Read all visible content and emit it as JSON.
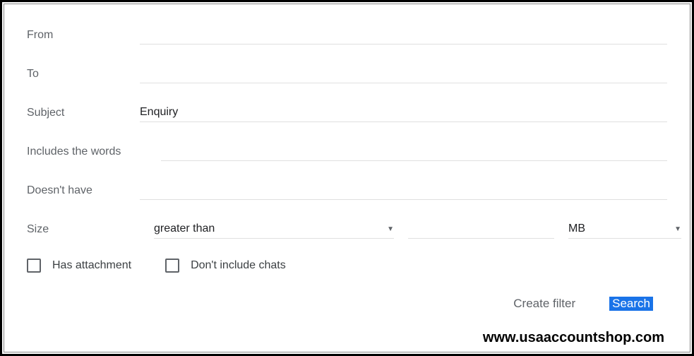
{
  "labels": {
    "from": "From",
    "to": "To",
    "subject": "Subject",
    "includes": "Includes the words",
    "doesnt_have": "Doesn't have",
    "size": "Size"
  },
  "values": {
    "from": "",
    "to": "",
    "subject": "Enquiry",
    "includes": "",
    "doesnt_have": "",
    "size_operator": "greater than",
    "size_value": "",
    "size_unit": "MB"
  },
  "checkboxes": {
    "has_attachment": "Has attachment",
    "dont_include_chats": "Don't include chats"
  },
  "actions": {
    "create_filter": "Create filter",
    "search": "Search"
  },
  "watermark": "www.usaaccountshop.com"
}
